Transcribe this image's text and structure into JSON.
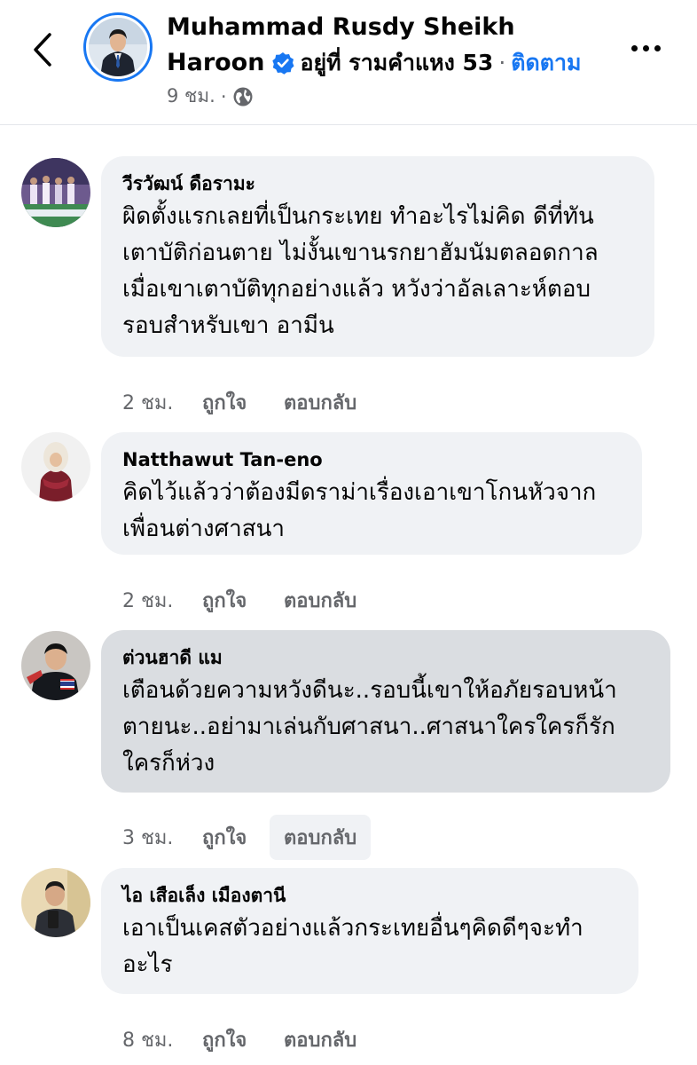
{
  "header": {
    "name_line1": "Muhammad Rusdy Sheikh",
    "name_line2": "Haroon",
    "location": "อยู่ที่ รามคำแหง 53",
    "separator": "·",
    "follow_label": "ติดตาม",
    "time": "9 ชม.",
    "meta_separator": "·",
    "privacy_icon": "globe-icon",
    "verified_icon": "verified-badge-icon",
    "back_icon": "chevron-left-icon",
    "more_icon": "more-dots-icon",
    "accent_color": "#1877f2"
  },
  "comments": [
    {
      "author": "วีรวัฒน์ ดือรามะ",
      "text": "ผิดตั้งแรกเลยที่เป็นกระเทย ทำอะไรไม่คิด ดีที่ทัน\nเตาบัติก่อนตาย ไม่งั้นเขานรกยาฮัมนัมตลอดกาล\nเมื่อเขาเตาบัติทุกอย่างแล้ว หวังว่าอัลเลาะห์ตอบ\nรอบสำหรับเขา อามีน",
      "time": "2 ชม.",
      "like": "ถูกใจ",
      "reply": "ตอบกลับ"
    },
    {
      "author": "Natthawut Tan-eno",
      "text": "คิดไว้แล้วว่าต้องมีดราม่าเรื่องเอาเขาโกนหัวจาก\nเพื่อนต่างศาสนา",
      "time": "2 ชม.",
      "like": "ถูกใจ",
      "reply": "ตอบกลับ"
    },
    {
      "author": "ต่วนฮาดี แม",
      "text": "เตือนด้วยความหวังดีนะ..รอบนี้เขาให้อภัยรอบหน้า\nตายนะ..อย่ามาเล่นกับศาสนา..ศาสนาใครใครก็รัก\nใครก็ห่วง",
      "time": "3 ชม.",
      "like": "ถูกใจ",
      "reply": "ตอบกลับ"
    },
    {
      "author": "ไอ เสือเล็ง เมืองตานี",
      "text": "เอาเป็นเคสตัวอย่างแล้วกระเทยอื่นๆคิดดีๆจะทำ\nอะไร",
      "time": "8 ชม.",
      "like": "ถูกใจ",
      "reply": "ตอบกลับ"
    }
  ]
}
